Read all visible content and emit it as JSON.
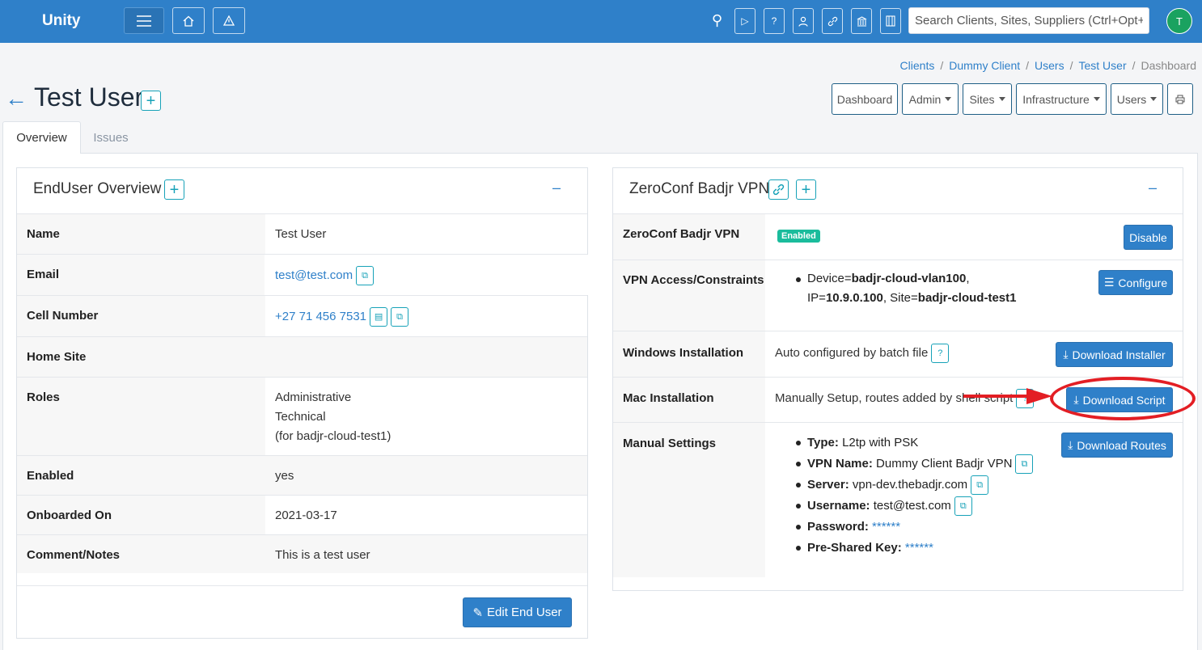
{
  "app": {
    "brand": "Unity",
    "avatar_initial": "T",
    "accent": "#2f80c9"
  },
  "topbar": {
    "icons": [
      "menu-icon",
      "home-icon",
      "alert-icon",
      "search-icon",
      "video-icon",
      "help-icon",
      "user-icon",
      "link-icon",
      "bank-icon",
      "building-icon"
    ],
    "search_placeholder": "Search Clients, Sites, Suppliers (Ctrl+Opt+F"
  },
  "breadcrumb": [
    "Clients",
    "Dummy Client",
    "Users",
    "Test User",
    "Dashboard"
  ],
  "page": {
    "title": "Test User"
  },
  "header_buttons": [
    "Dashboard",
    "Admin",
    "Sites",
    "Infrastructure",
    "Users"
  ],
  "tabs": [
    "Overview",
    "Issues"
  ],
  "overview": {
    "title": "EndUser Overview",
    "rows": [
      {
        "label": "Name",
        "value": "Test User"
      },
      {
        "label": "Email",
        "value": "test@test.com"
      },
      {
        "label": "Cell Number",
        "value": "+27 71 456 7531"
      },
      {
        "label": "Home Site",
        "value": ""
      },
      {
        "label": "Roles",
        "lines": [
          "Administrative",
          "Technical",
          "(for badjr-cloud-test1)"
        ]
      },
      {
        "label": "Enabled",
        "value": "yes"
      },
      {
        "label": "Onboarded On",
        "value": "2021-03-17"
      },
      {
        "label": "Comment/Notes",
        "value": "This is a test user"
      }
    ],
    "edit_button": "Edit End User"
  },
  "vpn": {
    "title": "ZeroConf Badjr VPN",
    "rows": {
      "status": {
        "label": "ZeroConf Badjr VPN",
        "badge": "Enabled",
        "button": "Disable"
      },
      "access": {
        "label": "VPN Access/Constraints",
        "device_key": "Device=",
        "device": "badjr-cloud-vlan100",
        "comma": ",",
        "ip_key": "IP=",
        "ip": "10.9.0.100",
        "site_key": ", Site=",
        "site": "badjr-cloud-test1",
        "button": "Configure"
      },
      "windows": {
        "label": "Windows Installation",
        "value": "Auto configured by batch file",
        "button": "Download Installer"
      },
      "mac": {
        "label": "Mac Installation",
        "value": "Manually Setup, routes added by shell script",
        "button": "Download Script"
      },
      "manual": {
        "label": "Manual Settings",
        "items": [
          {
            "key": "Type:",
            "value": "L2tp with PSK"
          },
          {
            "key": "VPN Name:",
            "value": "Dummy Client Badjr VPN"
          },
          {
            "key": "Server:",
            "value": "vpn-dev.thebadjr.com"
          },
          {
            "key": "Username:",
            "value": "test@test.com"
          },
          {
            "key": "Password:",
            "value": "******"
          },
          {
            "key": "Pre-Shared Key:",
            "value": "******"
          }
        ],
        "button": "Download Routes"
      }
    }
  },
  "annotation": {
    "color": "#e31e24"
  }
}
